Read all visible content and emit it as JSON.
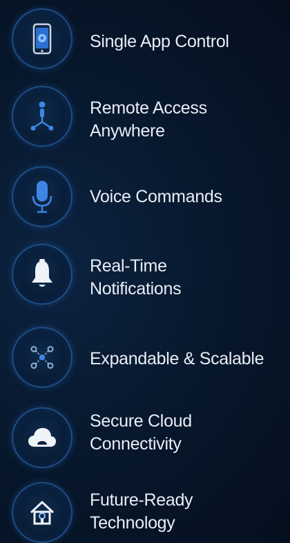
{
  "features": [
    {
      "label": "Single App Control",
      "icon": "smartphone-app-icon"
    },
    {
      "label": "Remote Access\nAnywhere",
      "icon": "remote-network-icon"
    },
    {
      "label": "Voice Commands",
      "icon": "microphone-icon"
    },
    {
      "label": "Real-Time\nNotifications",
      "icon": "bell-icon"
    },
    {
      "label": "Expandable & Scalable",
      "icon": "expand-nodes-icon"
    },
    {
      "label": "Secure Cloud\nConnectivity",
      "icon": "cloud-icon"
    },
    {
      "label": "Future-Ready\nTechnology",
      "icon": "smart-home-icon"
    }
  ],
  "colors": {
    "background": "#07172b",
    "circle_border": "#1d4d85",
    "icon_blue": "#3d86e6",
    "text": "#e9eef5"
  }
}
